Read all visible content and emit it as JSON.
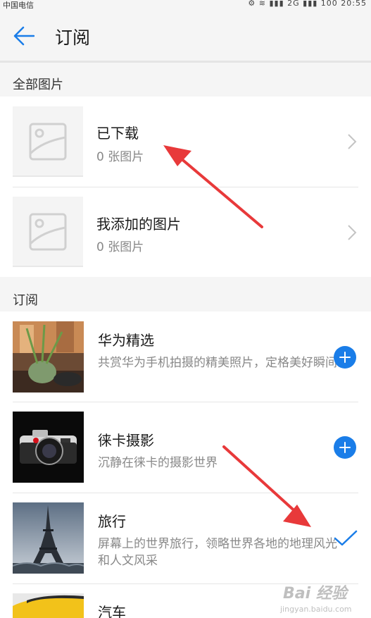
{
  "status_bar": {
    "carrier": "中国电信",
    "time": "20:55",
    "icons": "⚙ ≋ ▮▮▮ 2G ▮▮▮ 100"
  },
  "header": {
    "title": "订阅"
  },
  "all_pictures": {
    "label": "全部图片",
    "items": [
      {
        "title": "已下载",
        "subtitle": "0 张图片"
      },
      {
        "title": "我添加的图片",
        "subtitle": "0 张图片"
      }
    ]
  },
  "subscriptions": {
    "label": "订阅",
    "items": [
      {
        "title": "华为精选",
        "desc": "共赏华为手机拍摄的精美照片，定格美好瞬间",
        "state": "add",
        "thumb": "tea-still-life"
      },
      {
        "title": "徕卡摄影",
        "desc": "沉静在徕卡的摄影世界",
        "state": "add",
        "thumb": "leica-camera"
      },
      {
        "title": "旅行",
        "desc": "屏幕上的世界旅行，领略世界各地的地理风光和人文风采",
        "state": "subscribed",
        "thumb": "eiffel-tower"
      },
      {
        "title": "汽车",
        "desc": "",
        "state": "",
        "thumb": "yellow-car"
      }
    ]
  },
  "colors": {
    "accent": "#1a7de8",
    "annotation_arrow": "#e8393a"
  },
  "watermark": {
    "logo": "Bai 经验",
    "url": "jingyan.baidu.com"
  }
}
